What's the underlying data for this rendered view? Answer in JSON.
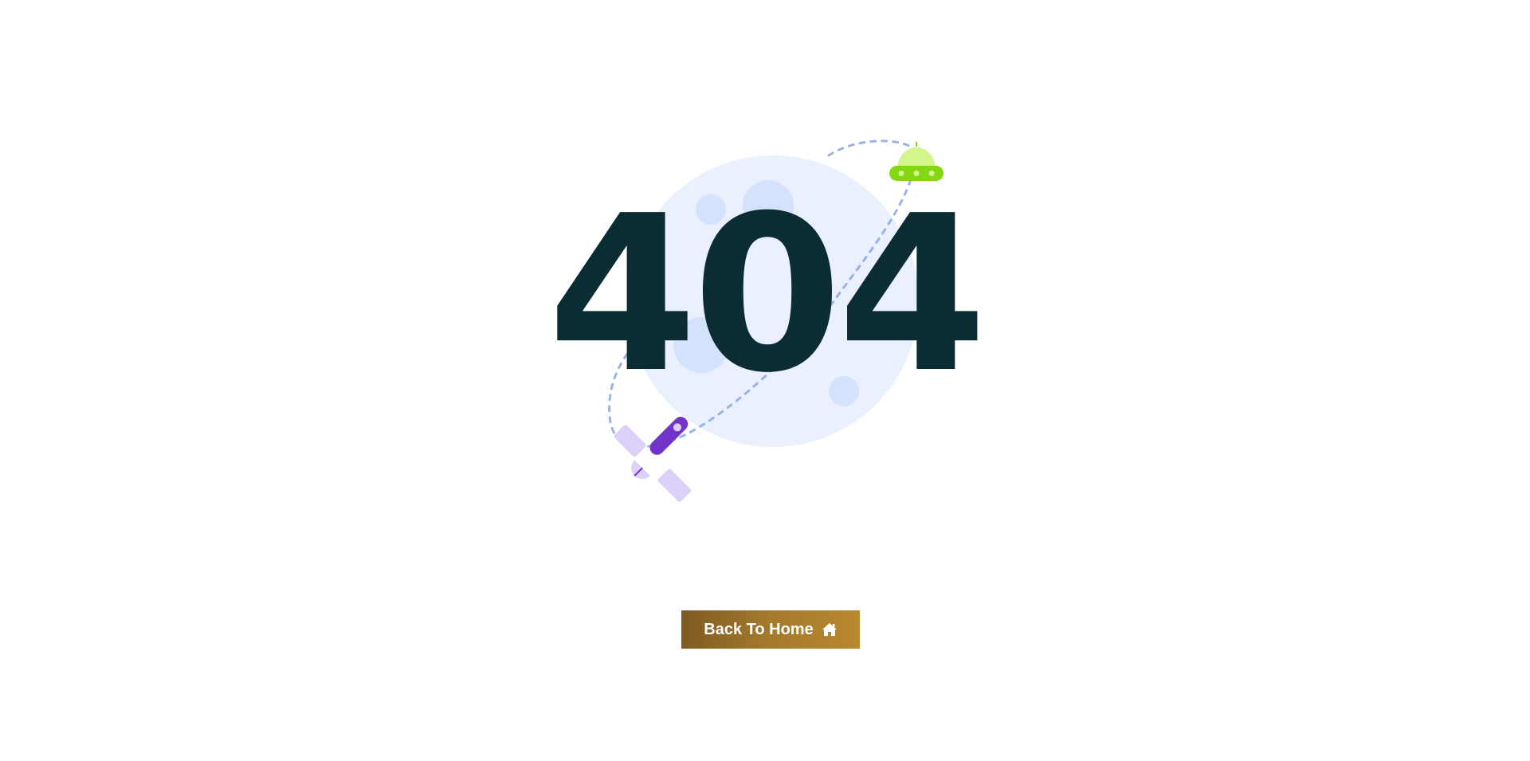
{
  "error": {
    "code": "404"
  },
  "button": {
    "label": "Back To Home",
    "icon": "home-icon"
  },
  "colors": {
    "code_text": "#0b2c33",
    "button_gradient_start": "#7e5b22",
    "button_gradient_end": "#b9882f",
    "moon": "#eaf0fe",
    "crater": "#d5e2fd",
    "orbit_dash": "#99b3e6",
    "ufo_dome": "#d3f68b",
    "ufo_body": "#84d713",
    "satellite_body": "#7233c9",
    "satellite_panels": "#ddd0fb"
  },
  "illustration": {
    "icons": [
      "moon-icon",
      "ufo-icon",
      "satellite-icon"
    ]
  }
}
